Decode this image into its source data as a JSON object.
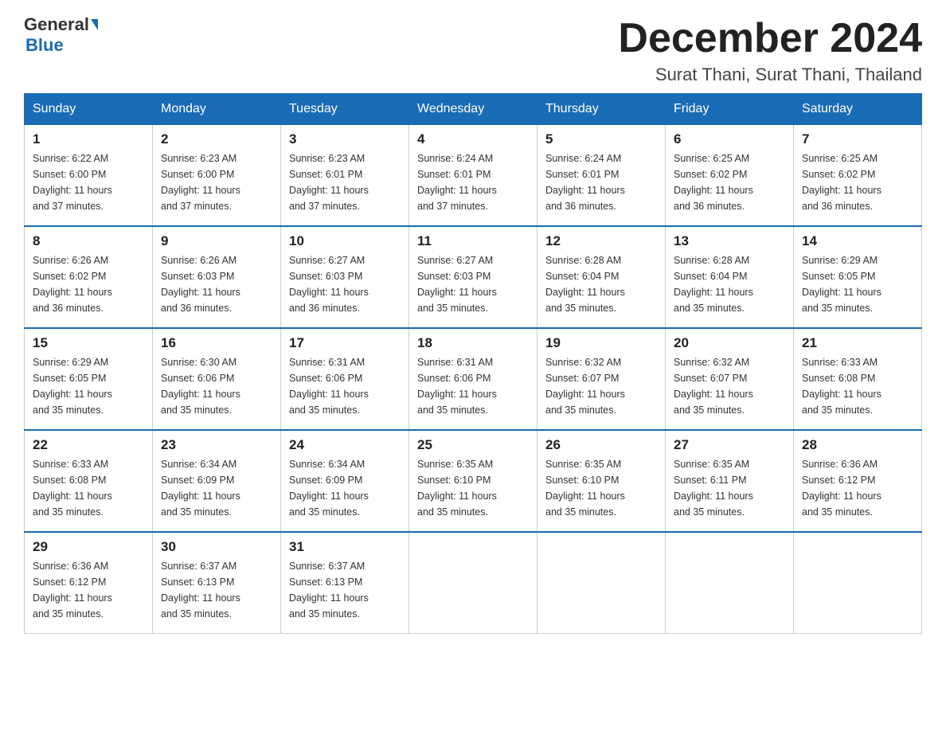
{
  "header": {
    "logo_general": "General",
    "logo_blue": "Blue",
    "month_title": "December 2024",
    "subtitle": "Surat Thani, Surat Thani, Thailand"
  },
  "days_of_week": [
    "Sunday",
    "Monday",
    "Tuesday",
    "Wednesday",
    "Thursday",
    "Friday",
    "Saturday"
  ],
  "weeks": [
    [
      {
        "day": "1",
        "sunrise": "6:22 AM",
        "sunset": "6:00 PM",
        "daylight": "11 hours and 37 minutes."
      },
      {
        "day": "2",
        "sunrise": "6:23 AM",
        "sunset": "6:00 PM",
        "daylight": "11 hours and 37 minutes."
      },
      {
        "day": "3",
        "sunrise": "6:23 AM",
        "sunset": "6:01 PM",
        "daylight": "11 hours and 37 minutes."
      },
      {
        "day": "4",
        "sunrise": "6:24 AM",
        "sunset": "6:01 PM",
        "daylight": "11 hours and 37 minutes."
      },
      {
        "day": "5",
        "sunrise": "6:24 AM",
        "sunset": "6:01 PM",
        "daylight": "11 hours and 36 minutes."
      },
      {
        "day": "6",
        "sunrise": "6:25 AM",
        "sunset": "6:02 PM",
        "daylight": "11 hours and 36 minutes."
      },
      {
        "day": "7",
        "sunrise": "6:25 AM",
        "sunset": "6:02 PM",
        "daylight": "11 hours and 36 minutes."
      }
    ],
    [
      {
        "day": "8",
        "sunrise": "6:26 AM",
        "sunset": "6:02 PM",
        "daylight": "11 hours and 36 minutes."
      },
      {
        "day": "9",
        "sunrise": "6:26 AM",
        "sunset": "6:03 PM",
        "daylight": "11 hours and 36 minutes."
      },
      {
        "day": "10",
        "sunrise": "6:27 AM",
        "sunset": "6:03 PM",
        "daylight": "11 hours and 36 minutes."
      },
      {
        "day": "11",
        "sunrise": "6:27 AM",
        "sunset": "6:03 PM",
        "daylight": "11 hours and 35 minutes."
      },
      {
        "day": "12",
        "sunrise": "6:28 AM",
        "sunset": "6:04 PM",
        "daylight": "11 hours and 35 minutes."
      },
      {
        "day": "13",
        "sunrise": "6:28 AM",
        "sunset": "6:04 PM",
        "daylight": "11 hours and 35 minutes."
      },
      {
        "day": "14",
        "sunrise": "6:29 AM",
        "sunset": "6:05 PM",
        "daylight": "11 hours and 35 minutes."
      }
    ],
    [
      {
        "day": "15",
        "sunrise": "6:29 AM",
        "sunset": "6:05 PM",
        "daylight": "11 hours and 35 minutes."
      },
      {
        "day": "16",
        "sunrise": "6:30 AM",
        "sunset": "6:06 PM",
        "daylight": "11 hours and 35 minutes."
      },
      {
        "day": "17",
        "sunrise": "6:31 AM",
        "sunset": "6:06 PM",
        "daylight": "11 hours and 35 minutes."
      },
      {
        "day": "18",
        "sunrise": "6:31 AM",
        "sunset": "6:06 PM",
        "daylight": "11 hours and 35 minutes."
      },
      {
        "day": "19",
        "sunrise": "6:32 AM",
        "sunset": "6:07 PM",
        "daylight": "11 hours and 35 minutes."
      },
      {
        "day": "20",
        "sunrise": "6:32 AM",
        "sunset": "6:07 PM",
        "daylight": "11 hours and 35 minutes."
      },
      {
        "day": "21",
        "sunrise": "6:33 AM",
        "sunset": "6:08 PM",
        "daylight": "11 hours and 35 minutes."
      }
    ],
    [
      {
        "day": "22",
        "sunrise": "6:33 AM",
        "sunset": "6:08 PM",
        "daylight": "11 hours and 35 minutes."
      },
      {
        "day": "23",
        "sunrise": "6:34 AM",
        "sunset": "6:09 PM",
        "daylight": "11 hours and 35 minutes."
      },
      {
        "day": "24",
        "sunrise": "6:34 AM",
        "sunset": "6:09 PM",
        "daylight": "11 hours and 35 minutes."
      },
      {
        "day": "25",
        "sunrise": "6:35 AM",
        "sunset": "6:10 PM",
        "daylight": "11 hours and 35 minutes."
      },
      {
        "day": "26",
        "sunrise": "6:35 AM",
        "sunset": "6:10 PM",
        "daylight": "11 hours and 35 minutes."
      },
      {
        "day": "27",
        "sunrise": "6:35 AM",
        "sunset": "6:11 PM",
        "daylight": "11 hours and 35 minutes."
      },
      {
        "day": "28",
        "sunrise": "6:36 AM",
        "sunset": "6:12 PM",
        "daylight": "11 hours and 35 minutes."
      }
    ],
    [
      {
        "day": "29",
        "sunrise": "6:36 AM",
        "sunset": "6:12 PM",
        "daylight": "11 hours and 35 minutes."
      },
      {
        "day": "30",
        "sunrise": "6:37 AM",
        "sunset": "6:13 PM",
        "daylight": "11 hours and 35 minutes."
      },
      {
        "day": "31",
        "sunrise": "6:37 AM",
        "sunset": "6:13 PM",
        "daylight": "11 hours and 35 minutes."
      },
      null,
      null,
      null,
      null
    ]
  ],
  "labels": {
    "sunrise": "Sunrise: ",
    "sunset": "Sunset: ",
    "daylight": "Daylight: "
  }
}
